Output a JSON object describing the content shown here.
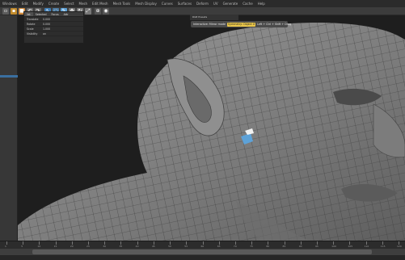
{
  "menubar": {
    "items": [
      "Windows",
      "Edit",
      "Modify",
      "Create",
      "Select",
      "Mesh",
      "Edit Mesh",
      "Mesh Tools",
      "Mesh Display",
      "Curves",
      "Surfaces",
      "Deform",
      "UV",
      "Generate",
      "Cache",
      "Help"
    ]
  },
  "hud": {
    "title_label": "Symmetry: Object X",
    "hint": "Left + Ctrl + Shift + Drag",
    "right_label": "RG8 Presets",
    "toolbar_hint": "Interactive: Mirror mode"
  },
  "attribute_panel": {
    "tabs": [
      "list",
      "Selected",
      "Focus",
      "Attr"
    ],
    "rows": [
      {
        "name": "Translate",
        "value": "0.000"
      },
      {
        "name": "Rotate",
        "value": "0.000"
      },
      {
        "name": "Scale",
        "value": "1.000"
      },
      {
        "name": "Visibility",
        "value": "on"
      }
    ]
  },
  "timeline": {
    "ticks": [
      "1",
      "5",
      "10",
      "15",
      "20",
      "25",
      "30",
      "35",
      "40",
      "45",
      "50",
      "55",
      "60",
      "65",
      "70",
      "75",
      "80",
      "85",
      "90",
      "95",
      "100",
      "105",
      "110",
      "115",
      "120"
    ]
  },
  "colors": {
    "viewport_bg": "#1e1e1e",
    "mesh_base": "#8a8a8a",
    "accent_blue": "#5da2d8",
    "hud_yellow": "#e9c64a"
  },
  "icons": [
    "new-scene-icon",
    "open-icon",
    "save-icon",
    "undo-icon",
    "redo-icon",
    "select-icon",
    "lasso-icon",
    "paint-icon",
    "move-icon",
    "rotate-icon",
    "scale-icon",
    "snap-icon",
    "render-icon"
  ]
}
